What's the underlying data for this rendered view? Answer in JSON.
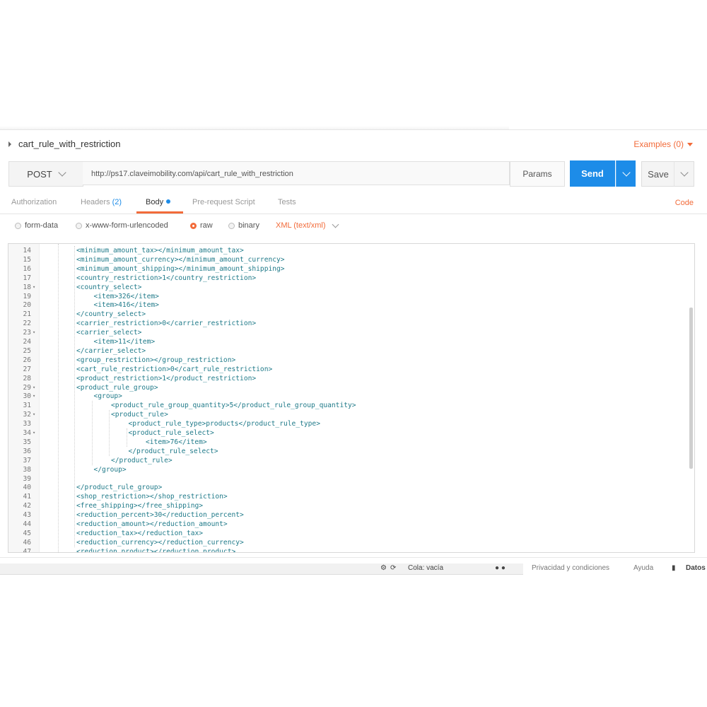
{
  "request": {
    "name": "cart_rule_with_restriction",
    "examples_label": "Examples (0)",
    "method": "POST",
    "url": "http://ps17.claveimobility.com/api/cart_rule_with_restriction",
    "params_label": "Params",
    "send_label": "Send",
    "save_label": "Save"
  },
  "tabs": [
    {
      "label": "Authorization"
    },
    {
      "label": "Headers",
      "count": "(2)"
    },
    {
      "label": "Body"
    },
    {
      "label": "Pre-request Script"
    },
    {
      "label": "Tests"
    }
  ],
  "code_link": "Code",
  "body_modes": [
    {
      "label": "form-data",
      "selected": false
    },
    {
      "label": "x-www-form-urlencoded",
      "selected": false
    },
    {
      "label": "raw",
      "selected": true
    },
    {
      "label": "binary",
      "selected": false
    }
  ],
  "content_type": "XML (text/xml)",
  "editor": {
    "lines": [
      {
        "n": "14",
        "indent": 1,
        "text": "<minimum_amount_tax></minimum_amount_tax>"
      },
      {
        "n": "15",
        "indent": 1,
        "text": "<minimum_amount_currency></minimum_amount_currency>"
      },
      {
        "n": "16",
        "indent": 1,
        "text": "<minimum_amount_shipping></minimum_amount_shipping>"
      },
      {
        "n": "17",
        "indent": 1,
        "text": "<country_restriction>1</country_restriction>"
      },
      {
        "n": "18",
        "indent": 1,
        "fold": true,
        "text": "<country_select>"
      },
      {
        "n": "19",
        "indent": 2,
        "text": "<item>326</item>"
      },
      {
        "n": "20",
        "indent": 2,
        "text": "<item>416</item>"
      },
      {
        "n": "21",
        "indent": 1,
        "text": "</country_select>"
      },
      {
        "n": "22",
        "indent": 1,
        "text": "<carrier_restriction>0</carrier_restriction>"
      },
      {
        "n": "23",
        "indent": 1,
        "fold": true,
        "text": "<carrier_select>"
      },
      {
        "n": "24",
        "indent": 2,
        "text": "<item>11</item>"
      },
      {
        "n": "25",
        "indent": 1,
        "text": "</carrier_select>"
      },
      {
        "n": "26",
        "indent": 1,
        "text": "<group_restriction></group_restriction>"
      },
      {
        "n": "27",
        "indent": 1,
        "text": "<cart_rule_restriction>0</cart_rule_restriction>"
      },
      {
        "n": "28",
        "indent": 1,
        "text": "<product_restriction>1</product_restriction>"
      },
      {
        "n": "29",
        "indent": 1,
        "fold": true,
        "text": "<product_rule_group>"
      },
      {
        "n": "30",
        "indent": 2,
        "fold": true,
        "text": "<group>"
      },
      {
        "n": "31",
        "indent": 3,
        "text": "<product_rule_group_quantity>5</product_rule_group_quantity>"
      },
      {
        "n": "32",
        "indent": 3,
        "fold": true,
        "text": "<product_rule>"
      },
      {
        "n": "33",
        "indent": 4,
        "text": "<product_rule_type>products</product_rule_type>"
      },
      {
        "n": "34",
        "indent": 4,
        "fold": true,
        "text": "<product_rule_select>"
      },
      {
        "n": "35",
        "indent": 5,
        "text": "<item>76</item>"
      },
      {
        "n": "36",
        "indent": 4,
        "text": "</product_rule_select>"
      },
      {
        "n": "37",
        "indent": 3,
        "text": "</product_rule>"
      },
      {
        "n": "38",
        "indent": 2,
        "text": "</group>"
      },
      {
        "n": "39",
        "indent": 1,
        "text": ""
      },
      {
        "n": "40",
        "indent": 1,
        "text": "</product_rule_group>"
      },
      {
        "n": "41",
        "indent": 1,
        "text": "<shop_restriction></shop_restriction>"
      },
      {
        "n": "42",
        "indent": 1,
        "text": "<free_shipping></free_shipping>"
      },
      {
        "n": "43",
        "indent": 1,
        "text": "<reduction_percent>30</reduction_percent>"
      },
      {
        "n": "44",
        "indent": 1,
        "text": "<reduction_amount></reduction_amount>"
      },
      {
        "n": "45",
        "indent": 1,
        "text": "<reduction_tax></reduction_tax>"
      },
      {
        "n": "46",
        "indent": 1,
        "text": "<reduction_currency></reduction_currency>"
      },
      {
        "n": "47",
        "indent": 1,
        "text": "<reduction_product></reduction_product>"
      }
    ]
  },
  "taskbar": {
    "queue": "Cola: vacía",
    "privacy": "Privacidad y condiciones",
    "help": "Ayuda",
    "data": "Datos"
  }
}
